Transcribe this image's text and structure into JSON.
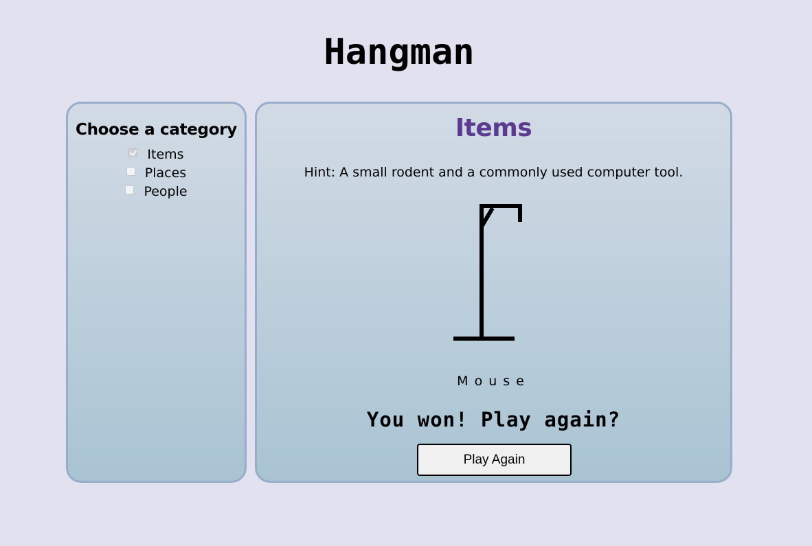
{
  "app": {
    "title": "Hangman"
  },
  "categories": {
    "heading": "Choose a category",
    "options": [
      {
        "label": "Items",
        "checked": true,
        "disabled": true
      },
      {
        "label": "Places",
        "checked": false,
        "disabled": false
      },
      {
        "label": "People",
        "checked": false,
        "disabled": false
      }
    ]
  },
  "game": {
    "category_title": "Items",
    "hint": "Hint: A small rodent and a commonly used computer tool.",
    "word": "Mouse",
    "result_message": "You won! Play again?",
    "play_again_label": "Play Again",
    "colors": {
      "category_title": "#5b3a8f"
    }
  }
}
